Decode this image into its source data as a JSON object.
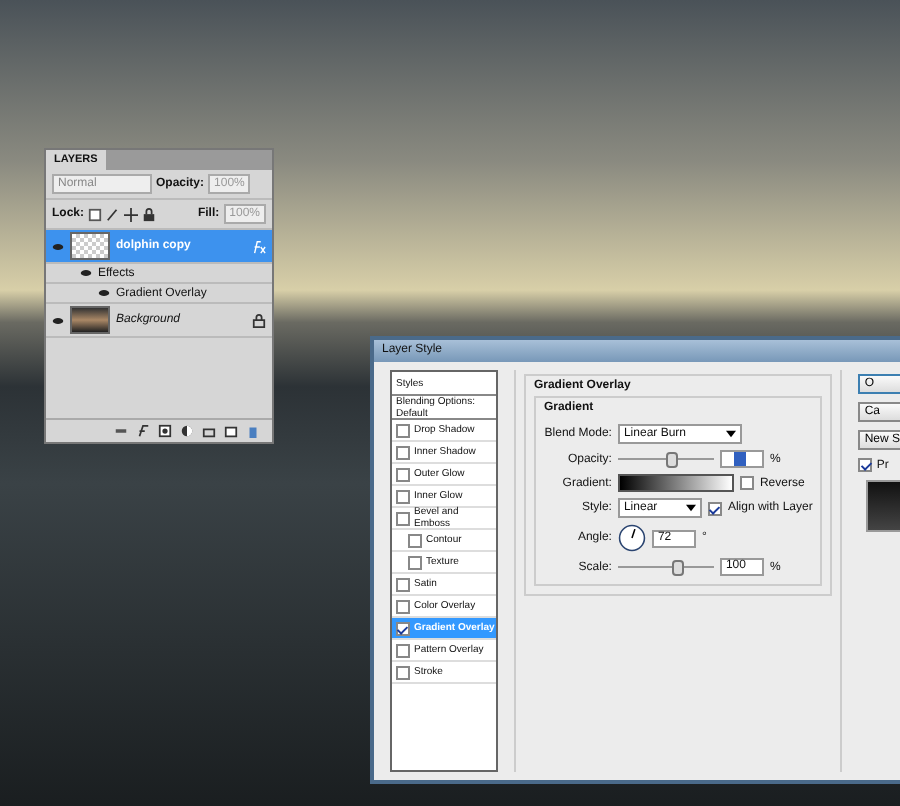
{
  "layers_panel": {
    "title": "LAYERS",
    "blend_mode": "Normal",
    "opacity_label": "Opacity:",
    "opacity": "100%",
    "lock_label": "Lock:",
    "fill_label": "Fill:",
    "fill": "100%",
    "layers": [
      {
        "name": "dolphin copy",
        "kind": "layer",
        "selected": true,
        "visible": true,
        "effects_label": "Effects",
        "effects": [
          "Gradient Overlay"
        ]
      },
      {
        "name": "Background",
        "kind": "background",
        "selected": false,
        "visible": true
      }
    ]
  },
  "dialog": {
    "title": "Layer Style",
    "styles": [
      {
        "label": "Styles",
        "kind": "header",
        "selected": false
      },
      {
        "label": "Blending Options: Default",
        "kind": "header",
        "selected": false
      },
      {
        "label": "Drop Shadow",
        "kind": "check",
        "checked": false,
        "selected": false
      },
      {
        "label": "Inner Shadow",
        "kind": "check",
        "checked": false,
        "selected": false
      },
      {
        "label": "Outer Glow",
        "kind": "check",
        "checked": false,
        "selected": false
      },
      {
        "label": "Inner Glow",
        "kind": "check",
        "checked": false,
        "selected": false
      },
      {
        "label": "Bevel and Emboss",
        "kind": "check",
        "checked": false,
        "selected": false,
        "children": [
          {
            "label": "Contour",
            "checked": false
          },
          {
            "label": "Texture",
            "checked": false
          }
        ]
      },
      {
        "label": "Satin",
        "kind": "check",
        "checked": false,
        "selected": false
      },
      {
        "label": "Color Overlay",
        "kind": "check",
        "checked": false,
        "selected": false
      },
      {
        "label": "Gradient Overlay",
        "kind": "check",
        "checked": true,
        "selected": true
      },
      {
        "label": "Pattern Overlay",
        "kind": "check",
        "checked": false,
        "selected": false
      },
      {
        "label": "Stroke",
        "kind": "check",
        "checked": false,
        "selected": false
      }
    ],
    "section_title": "Gradient Overlay",
    "group_title": "Gradient",
    "blend_mode_label": "Blend Mode:",
    "blend_mode": "Linear Burn",
    "opacity_label": "Opacity:",
    "opacity_slider": {
      "level": 0.55
    },
    "opacity_unit": "%",
    "gradient_label": "Gradient:",
    "reverse": {
      "label": "Reverse",
      "checked": false
    },
    "style_label": "Style:",
    "style": "Linear",
    "align": {
      "label": "Align with Layer",
      "checked": true
    },
    "angle_label": "Angle:",
    "angle": "72",
    "angle_unit": "°",
    "scale_label": "Scale:",
    "scale_slider": {
      "level": 0.6
    },
    "scale": "100",
    "scale_unit": "%",
    "buttons": [
      "O",
      "Ca",
      "New S"
    ],
    "preview": {
      "label": "Pr",
      "checked": true
    }
  }
}
